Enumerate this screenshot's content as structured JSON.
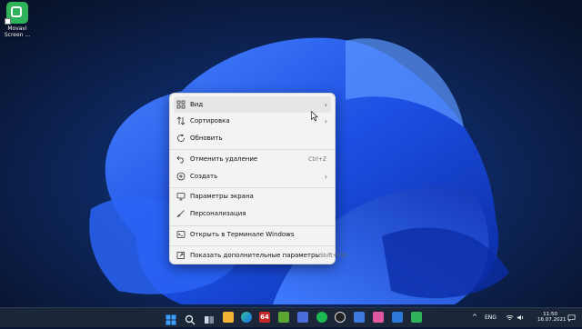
{
  "desktop": {
    "icons": [
      {
        "label_line1": "Movavi",
        "label_line2": "Screen ...",
        "icon": "movavi-app-icon"
      }
    ]
  },
  "context_menu": {
    "items": [
      {
        "label": "Вид",
        "icon": "grid-icon",
        "has_submenu": true,
        "shortcut": ""
      },
      {
        "label": "Сортировка",
        "icon": "sort-icon",
        "has_submenu": true,
        "shortcut": ""
      },
      {
        "label": "Обновить",
        "icon": "refresh-icon",
        "has_submenu": false,
        "shortcut": ""
      },
      {
        "label": "Отменить удаление",
        "icon": "undo-icon",
        "has_submenu": false,
        "shortcut": "Ctrl+Z"
      },
      {
        "label": "Создать",
        "icon": "plus-circle-icon",
        "has_submenu": true,
        "shortcut": ""
      },
      {
        "label": "Параметры экрана",
        "icon": "display-icon",
        "has_submenu": false,
        "shortcut": ""
      },
      {
        "label": "Персонализация",
        "icon": "brush-icon",
        "has_submenu": false,
        "shortcut": ""
      },
      {
        "label": "Открыть в Терминале Windows",
        "icon": "terminal-icon",
        "has_submenu": false,
        "shortcut": ""
      },
      {
        "label": "Показать дополнительные параметры",
        "icon": "share-icon",
        "has_submenu": false,
        "shortcut": "Shift+F10"
      }
    ],
    "submenu_arrow": "›",
    "hovered_item": "Вид"
  },
  "taskbar": {
    "apps": [
      "start-icon",
      "search-icon",
      "taskview-icon",
      "explorer-icon",
      "edge-icon",
      "aida64-icon",
      "greenshot-icon",
      "app-icon",
      "spotify-icon",
      "obs-icon",
      "app-icon",
      "pictures-icon",
      "store-icon",
      "movavi-icon"
    ],
    "aida_label": "64",
    "tray": {
      "chevron": "^",
      "language": "ENG",
      "time": "11:50",
      "date": "16.07.2021"
    }
  },
  "colors": {
    "menu_bg": "#f3f3f3",
    "hover_bg": "#e6e6e6",
    "taskbar_bg": "#1b2738",
    "wallpaper_blue": "#1b4fe0"
  }
}
